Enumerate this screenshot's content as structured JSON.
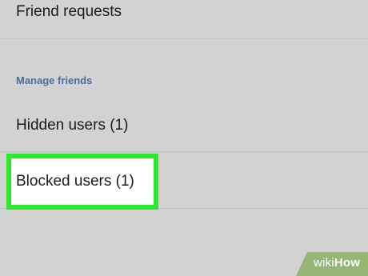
{
  "settings": {
    "friend_requests_label": "Friend requests",
    "section_manage_friends": "Manage friends",
    "hidden_users_label": "Hidden users (1)",
    "blocked_users_label": "Blocked users (1)"
  },
  "watermark": {
    "prefix": "wiki",
    "suffix": "How"
  },
  "colors": {
    "background": "#d2d2d2",
    "section_header": "#4c6d9a",
    "highlight": "#2ee82e",
    "watermark": "#8fb36a"
  }
}
